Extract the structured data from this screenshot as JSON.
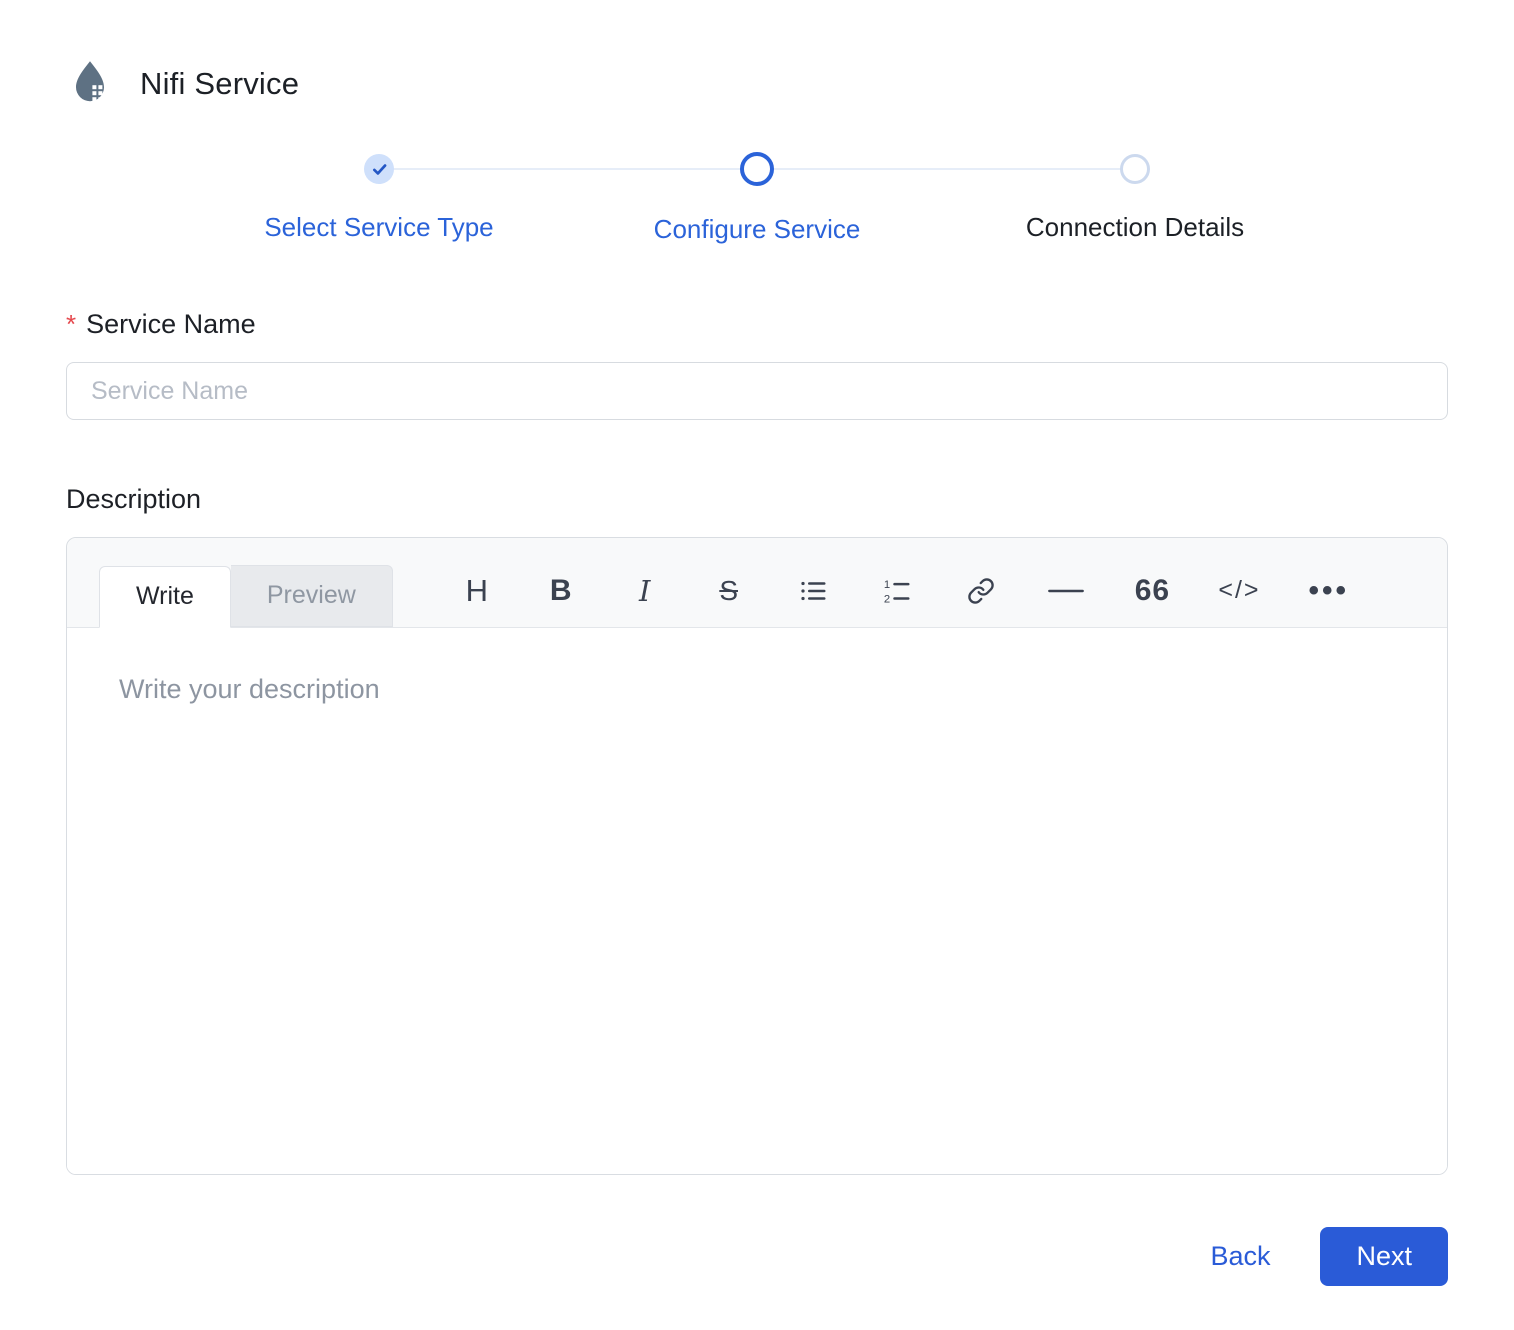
{
  "header": {
    "title": "Nifi Service",
    "logo": "nifi-drop-icon"
  },
  "stepper": {
    "steps": [
      {
        "label": "Select Service Type",
        "state": "completed"
      },
      {
        "label": "Configure Service",
        "state": "active"
      },
      {
        "label": "Connection Details",
        "state": "pending"
      }
    ]
  },
  "form": {
    "service_name": {
      "required_marker": "*",
      "label": "Service Name",
      "placeholder": "Service Name",
      "value": ""
    },
    "description": {
      "label": "Description",
      "editor": {
        "tabs": [
          {
            "label": "Write",
            "active": true
          },
          {
            "label": "Preview",
            "active": false
          }
        ],
        "toolbar": [
          {
            "name": "heading",
            "glyph": "H"
          },
          {
            "name": "bold",
            "glyph": "B"
          },
          {
            "name": "italic",
            "glyph": "I"
          },
          {
            "name": "strikethrough",
            "glyph": "S"
          },
          {
            "name": "bulleted-list",
            "glyph": ""
          },
          {
            "name": "numbered-list",
            "glyph": ""
          },
          {
            "name": "link",
            "glyph": ""
          },
          {
            "name": "horizontal-rule",
            "glyph": ""
          },
          {
            "name": "quote",
            "glyph": "66"
          },
          {
            "name": "code",
            "glyph": "</>"
          },
          {
            "name": "more-options",
            "glyph": "•••"
          }
        ],
        "placeholder": "Write your description",
        "value": ""
      }
    }
  },
  "footer": {
    "back_label": "Back",
    "next_label": "Next"
  },
  "colors": {
    "primary_blue": "#2a5bd7",
    "step_accent_text": "#2b63d9",
    "completed_step_fill": "#cfe0fb",
    "completed_check": "#2457c5",
    "pending_ring": "#ccd9ee",
    "track_line": "#e6edf8",
    "input_border": "#d7dbe0",
    "editor_header_bg": "#f8f9fa",
    "inactive_tab_bg": "#e8eaed",
    "placeholder_text": "#8d95a1",
    "required_red": "#e5484d",
    "text_dark": "#1c2026",
    "logo_slate": "#5e7183"
  }
}
